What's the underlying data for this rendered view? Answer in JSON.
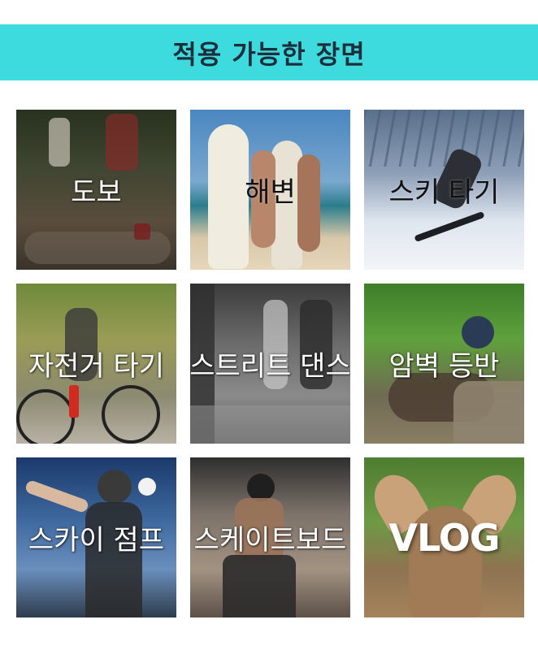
{
  "header": {
    "title": "적용 가능한 장면",
    "background_color": "#3ddbdd"
  },
  "scenes": [
    {
      "label": "도보"
    },
    {
      "label": "해변"
    },
    {
      "label": "스키 타기"
    },
    {
      "label": "자전거 타기"
    },
    {
      "label": "스트리트 댄스"
    },
    {
      "label": "암벽 등반"
    },
    {
      "label": "스카이 점프"
    },
    {
      "label": "스케이트보드"
    },
    {
      "label": "VLOG"
    }
  ]
}
